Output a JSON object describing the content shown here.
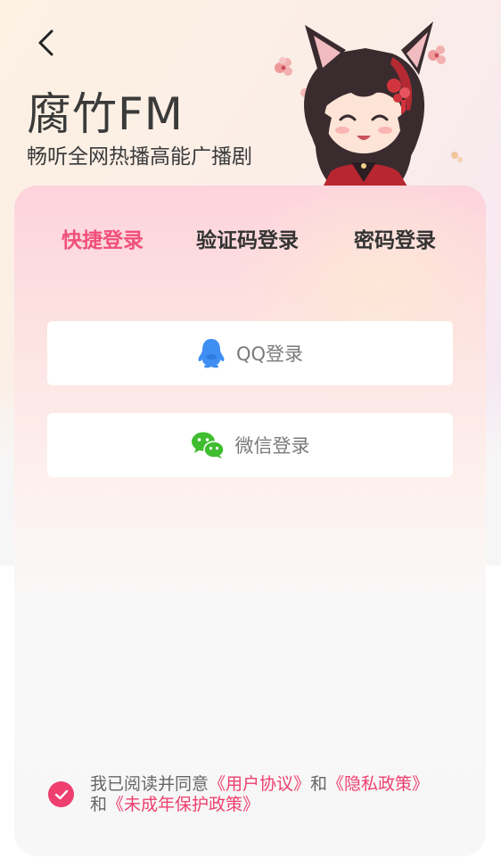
{
  "header": {
    "back_icon": "chevron-left-icon",
    "brand_title": "腐竹FM",
    "slogan": "畅听全网热播高能广播剧"
  },
  "tabs": [
    {
      "label": "快捷登录",
      "active": true
    },
    {
      "label": "验证码登录",
      "active": false
    },
    {
      "label": "密码登录",
      "active": false
    }
  ],
  "login_options": {
    "qq": {
      "label": "QQ登录",
      "icon": "qq-penguin-icon",
      "color": "#3f8ef3"
    },
    "wechat": {
      "label": "微信登录",
      "icon": "wechat-icon",
      "color": "#3fbd2f"
    }
  },
  "agreement": {
    "checked": true,
    "prefix": "我已阅读并同意",
    "user_agreement": "《用户协议》",
    "and1": "和",
    "privacy_policy": "《隐私政策》",
    "and2": "和",
    "minor_protection": "《未成年保护政策》"
  },
  "colors": {
    "accent": "#f0507a",
    "check_bg": "#ee3f6f"
  }
}
